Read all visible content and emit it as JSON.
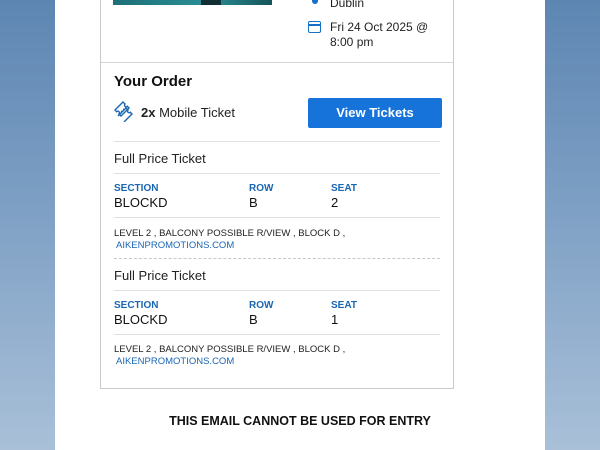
{
  "event": {
    "city": "Dublin",
    "date_line1": "Fri 24 Oct 2025 @",
    "date_line2": "8:00 pm"
  },
  "order": {
    "title": "Your Order",
    "quantity": "2x",
    "ticket_type": "Mobile Ticket",
    "view_button": "View Tickets"
  },
  "tickets": [
    {
      "title": "Full Price Ticket",
      "section_label": "SECTION",
      "section": "BLOCKD",
      "row_label": "ROW",
      "row": "B",
      "seat_label": "SEAT",
      "seat": "2",
      "note": "LEVEL 2 , BALCONY POSSIBLE R/VIEW , BLOCK D ,",
      "link": "AIKENPROMOTIONS.COM"
    },
    {
      "title": "Full Price Ticket",
      "section_label": "SECTION",
      "section": "BLOCKD",
      "row_label": "ROW",
      "row": "B",
      "seat_label": "SEAT",
      "seat": "1",
      "note": "LEVEL 2 , BALCONY POSSIBLE R/VIEW , BLOCK D ,",
      "link": "AIKENPROMOTIONS.COM"
    }
  ],
  "footer": {
    "message": "THIS EMAIL CANNOT BE USED FOR ENTRY"
  },
  "colors": {
    "accent": "#1673d9",
    "label_blue": "#1a66b3"
  },
  "icons": [
    "location-pin-icon",
    "calendar-icon",
    "ticket-icon"
  ]
}
